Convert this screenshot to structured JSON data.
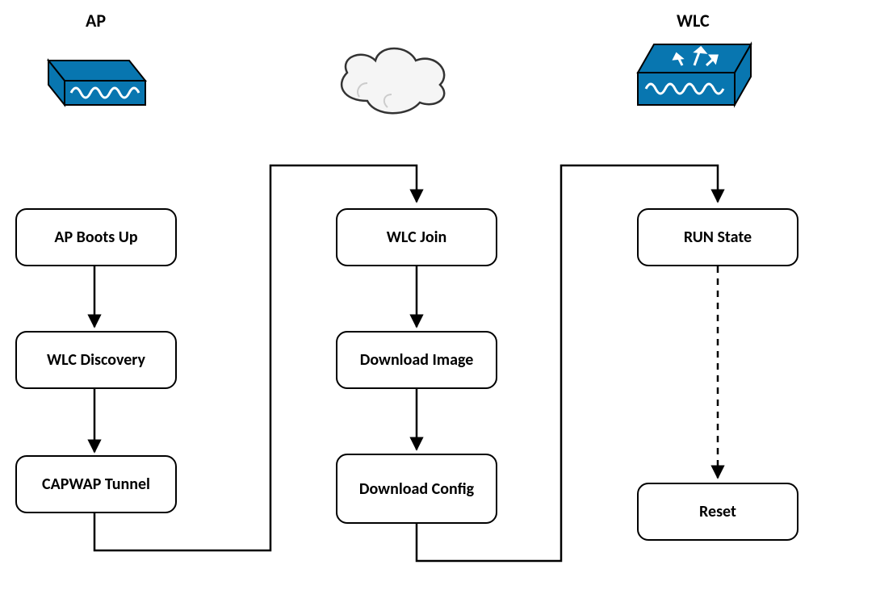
{
  "headers": {
    "ap": "AP",
    "wlc": "WLC"
  },
  "nodes": {
    "boots": {
      "label": "AP Boots Up"
    },
    "discover": {
      "label": "WLC Discovery"
    },
    "capwap": {
      "label": "CAPWAP Tunnel"
    },
    "join": {
      "label": "WLC Join"
    },
    "image": {
      "label": "Download Image"
    },
    "config": {
      "label": "Download Config"
    },
    "run": {
      "label": "RUN State"
    },
    "reset": {
      "label": "Reset"
    }
  },
  "edges": [
    {
      "from": "boots",
      "to": "discover",
      "style": "solid"
    },
    {
      "from": "discover",
      "to": "capwap",
      "style": "solid"
    },
    {
      "from": "capwap",
      "to": "join",
      "style": "solid"
    },
    {
      "from": "join",
      "to": "image",
      "style": "solid"
    },
    {
      "from": "image",
      "to": "config",
      "style": "solid"
    },
    {
      "from": "config",
      "to": "run",
      "style": "solid"
    },
    {
      "from": "run",
      "to": "reset",
      "style": "dashed"
    }
  ],
  "colors": {
    "device_blue": "#0876B0",
    "box_stroke": "#000000"
  }
}
